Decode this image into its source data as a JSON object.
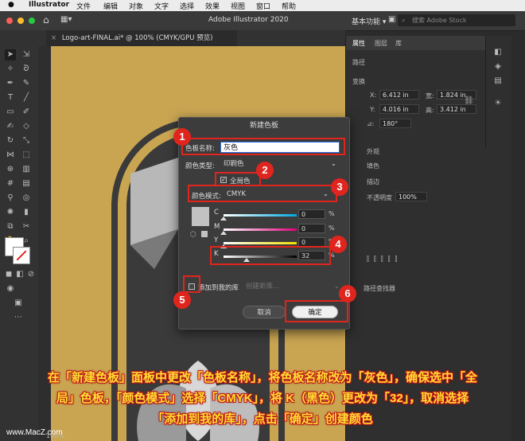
{
  "menubar": {
    "app": "Illustrator",
    "items": [
      "文件",
      "编辑",
      "对象",
      "文字",
      "选择",
      "效果",
      "视图",
      "窗口",
      "帮助"
    ]
  },
  "appbar": {
    "title": "Adobe Illustrator 2020",
    "workspace": "基本功能",
    "search_placeholder": "搜索 Adobe Stock"
  },
  "document": {
    "tab": "Logo-art-FINAL.ai* @ 100% (CMYK/GPU 预览)"
  },
  "properties": {
    "tabs": [
      "属性",
      "图层",
      "库"
    ],
    "section_path": "路径",
    "section_transform": "变换",
    "x_label": "X:",
    "x": "6.412 in",
    "y_label": "Y:",
    "y": "4.016 in",
    "w_label": "宽:",
    "w": "1.824 in",
    "h_label": "高:",
    "h": "3.412 in",
    "angle_label": "⊿:",
    "angle": "180°",
    "appearance": "外观",
    "fill": "填色",
    "stroke": "描边",
    "opacity_label": "不透明度",
    "opacity": "100%",
    "pathfinder": "路径查找器"
  },
  "dialog": {
    "title": "新建色板",
    "swatch_name_label": "色板名称:",
    "swatch_name": "灰色",
    "color_type_label": "颜色类型:",
    "color_type": "印刷色",
    "global_label": "全局色",
    "color_mode_label": "颜色模式:",
    "color_mode": "CMYK",
    "channels": [
      {
        "name": "C",
        "value": "0",
        "level": 0.0,
        "color": "#00a8e0"
      },
      {
        "name": "M",
        "value": "0",
        "level": 0.0,
        "color": "#e0007a"
      },
      {
        "name": "Y",
        "value": "0",
        "level": 0.0,
        "color": "#f0e000"
      },
      {
        "name": "K",
        "value": "32",
        "level": 0.32,
        "color": "#000000"
      }
    ],
    "percent": "%",
    "add_to_library": "添加到我的库",
    "create_library": "创建新库...",
    "cancel": "取消",
    "ok": "确定"
  },
  "annotations": {
    "badges": [
      "1",
      "2",
      "3",
      "4",
      "5",
      "6"
    ]
  },
  "caption": {
    "line1": "在「新建色板」面板中更改「色板名称」，将色板名称改为「灰色」，确保选中「全",
    "line2": "局」色板，「颜色模式」选择「CMYK」，将 K（黑色）更改为「32」，取消选择",
    "line3": "「添加到我的库」，点击「确定」创建颜色"
  },
  "watermark": "www.MacZ.com",
  "zoom": "100%"
}
